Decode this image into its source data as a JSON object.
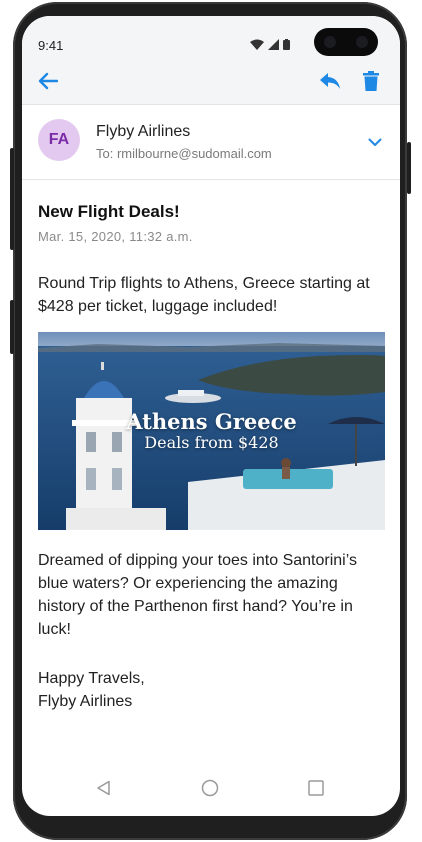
{
  "status_bar": {
    "time": "9:41",
    "icons": [
      "wifi-icon",
      "signal-icon",
      "battery-icon"
    ]
  },
  "app_bar": {
    "back_icon": "arrow-back-icon",
    "reply_icon": "reply-icon",
    "delete_icon": "trash-icon",
    "accent": "#1e88e5"
  },
  "message": {
    "sender_initials": "FA",
    "sender_name": "Flyby Airlines",
    "recipient": "To: rmilbourne@sudomail.com",
    "subject": "New Flight Deals!",
    "date": "Mar. 15, 2020, 11:32 a.m.",
    "intro": "Round Trip flights to Athens, Greece starting at $428 per ticket, luggage included!",
    "banner": {
      "title": "Athens Greece",
      "subtitle": "Deals from $428"
    },
    "body": "Dreamed of dipping your toes into Santorini’s blue waters? Or experiencing the amazing history of the Parthenon first hand? You’re in luck!",
    "signoff": "Happy Travels,",
    "signature": "Flyby Airlines"
  },
  "nav_bar": {
    "icons": [
      "back-triangle-icon",
      "home-circle-icon",
      "recents-square-icon"
    ]
  }
}
